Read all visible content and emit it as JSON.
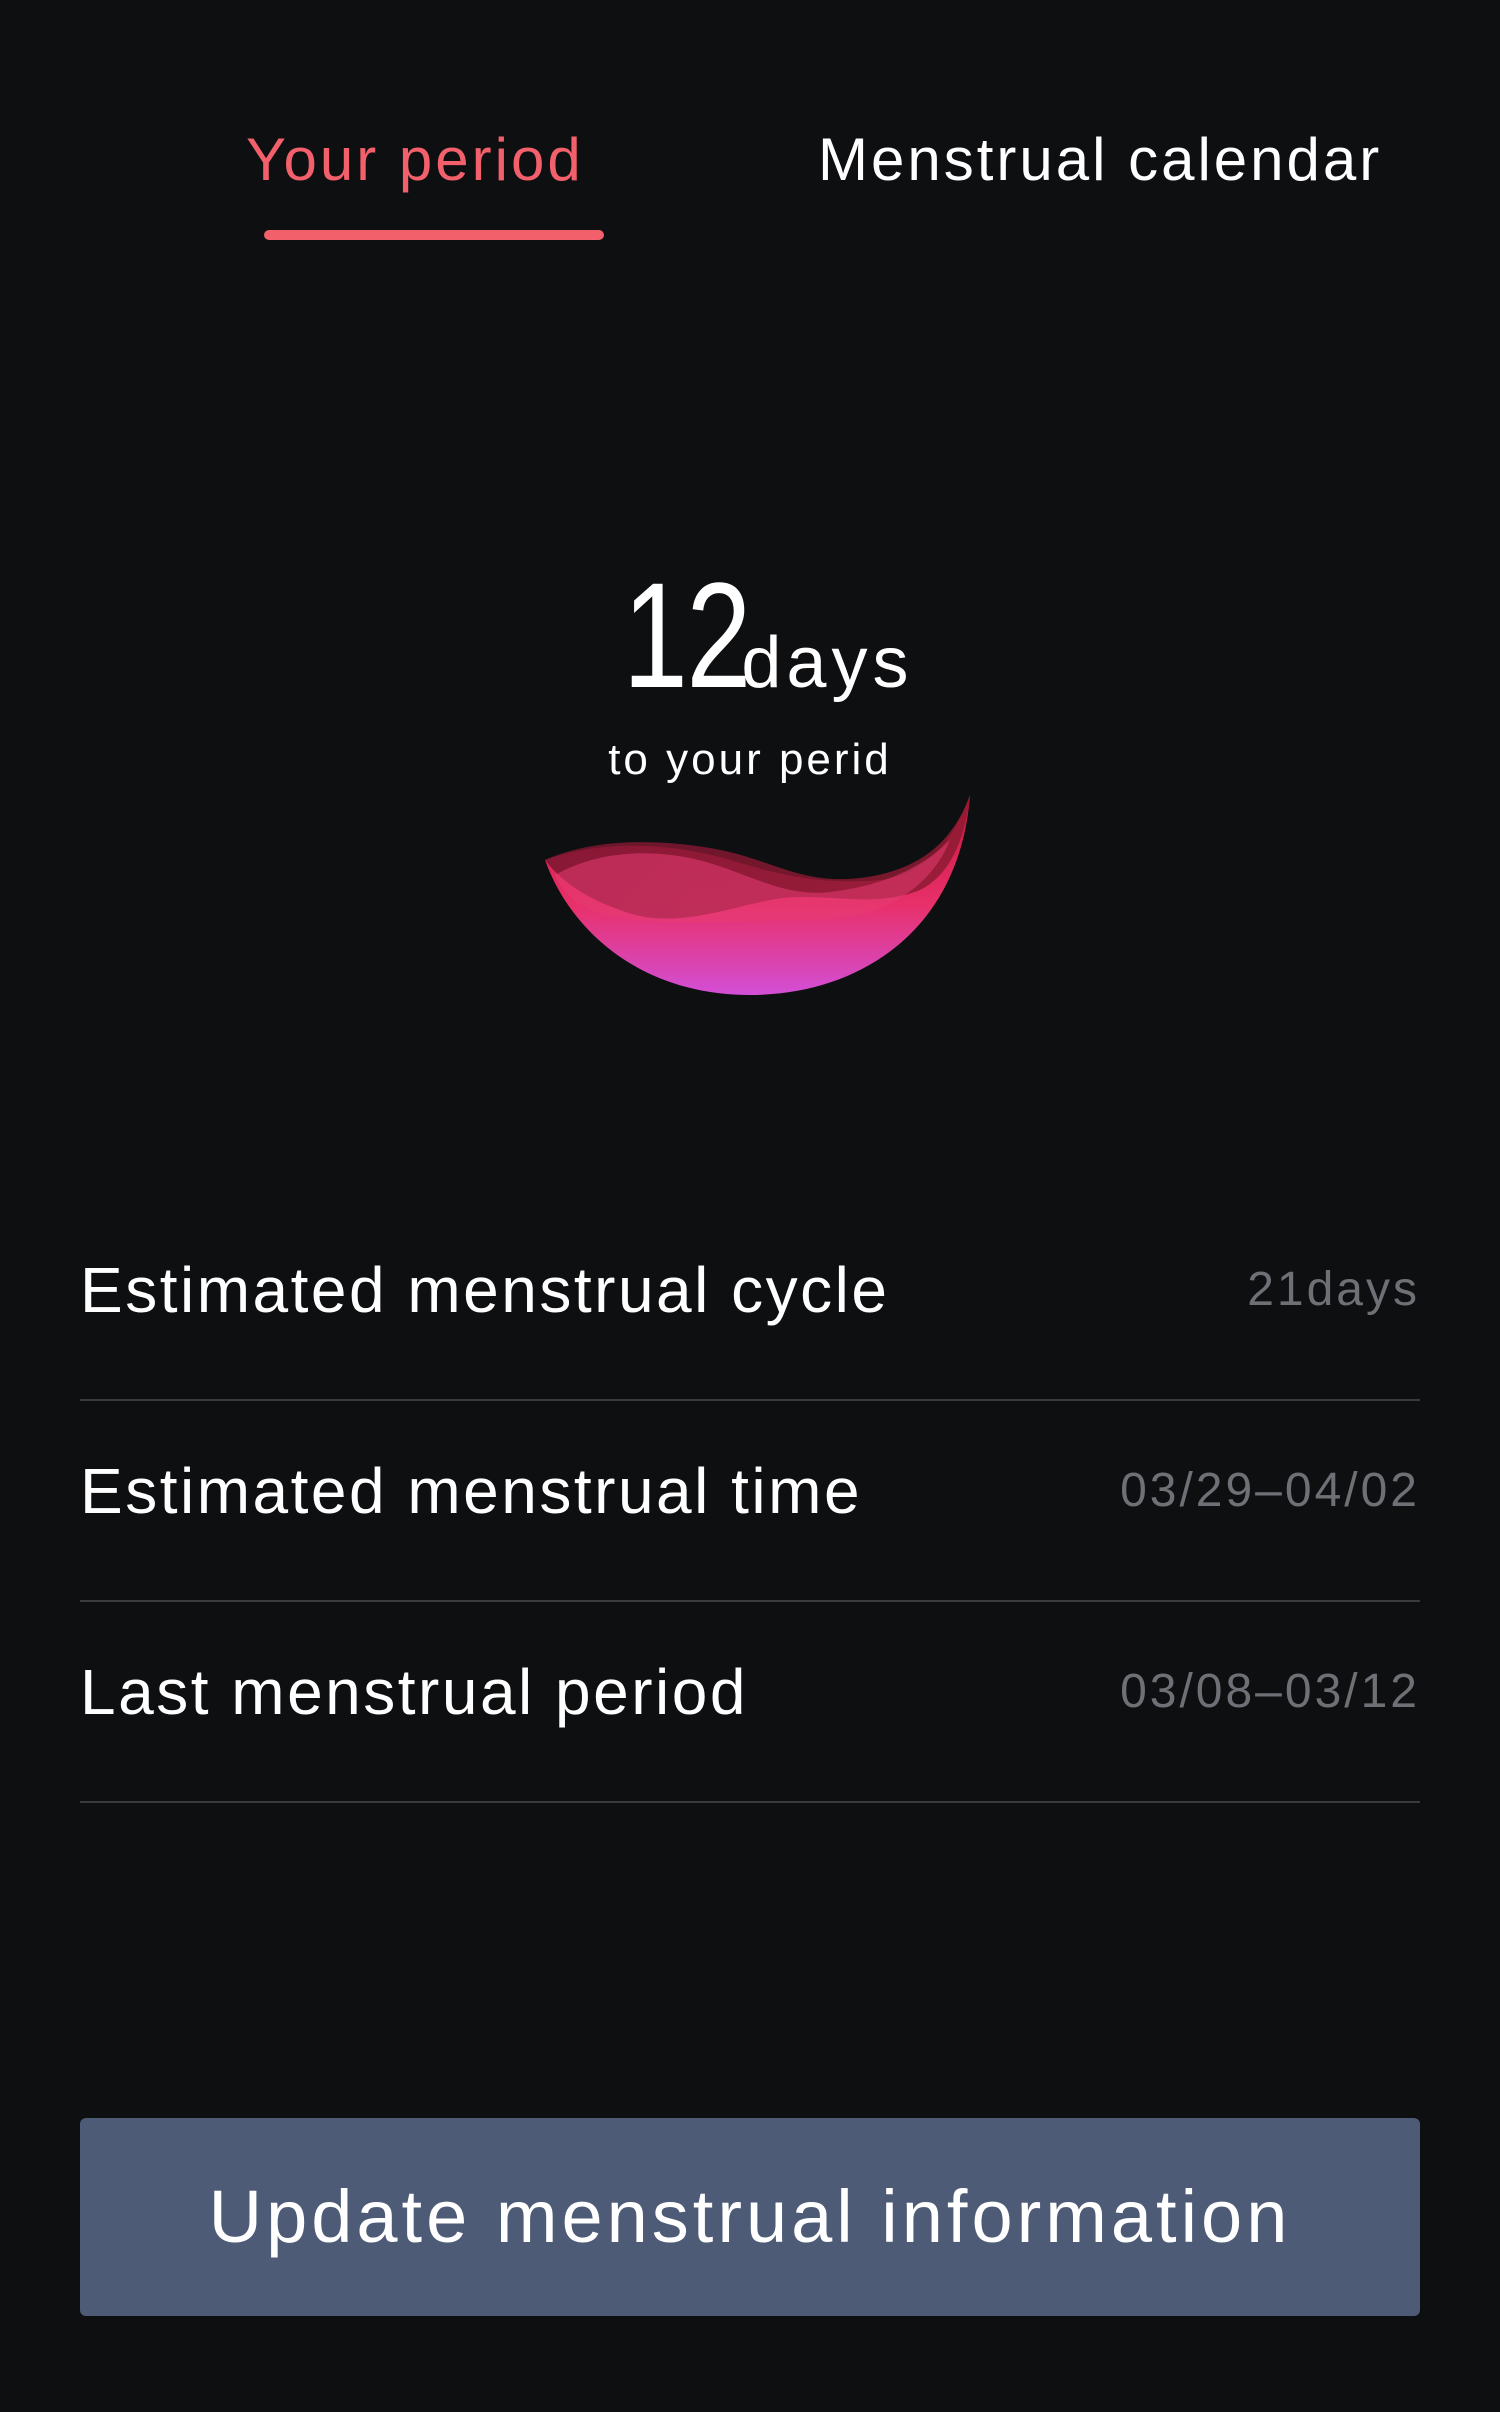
{
  "tabs": {
    "active_label": "Your period",
    "inactive_label": "Menstrual calendar"
  },
  "countdown": {
    "number": "12",
    "unit": "days",
    "caption": "to your perid"
  },
  "info": {
    "rows": [
      {
        "label": "Estimated menstrual cycle",
        "value": "21days"
      },
      {
        "label": "Estimated menstrual time",
        "value": "03/29–04/02"
      },
      {
        "label": "Last menstrual period",
        "value": "03/08–03/12"
      }
    ]
  },
  "actions": {
    "update_label": "Update menstrual information"
  },
  "colors": {
    "background": "#0e0f11",
    "accent": "#f2606c",
    "button": "#4e5b76",
    "secondary_text": "#6f7076",
    "divider": "#3a3b3f"
  },
  "icons": {
    "wave": "menstrual-wave-icon"
  }
}
